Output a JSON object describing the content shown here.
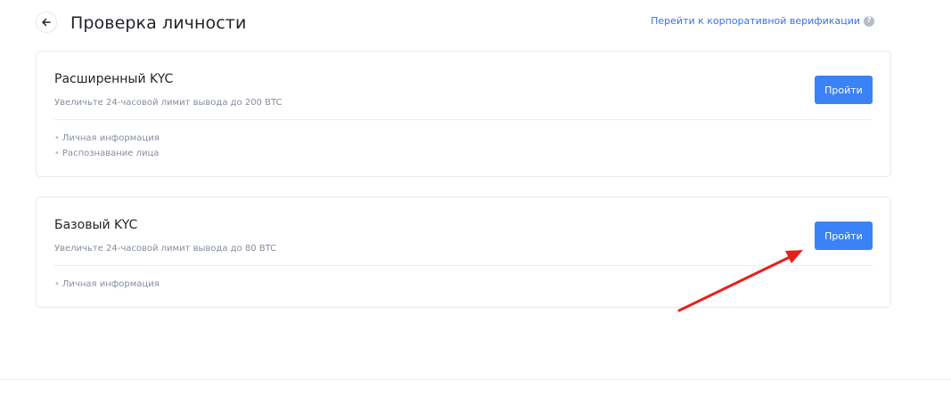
{
  "header": {
    "title": "Проверка личности",
    "back_icon": "arrow-left-icon",
    "corporate_link": "Перейти к корпоративной верификации",
    "help_icon": "question-circle-icon",
    "help_glyph": "?"
  },
  "cards": [
    {
      "title": "Расширенный KYC",
      "subtitle": "Увеличьте 24-часовой лимит вывода до 200 BTC",
      "items": [
        "Личная информация",
        "Распознавание лица"
      ],
      "button": "Пройти"
    },
    {
      "title": "Базовый KYC",
      "subtitle": "Увеличьте 24-часовой лимит вывода до 80 BTC",
      "items": [
        "Личная информация"
      ],
      "button": "Пройти"
    }
  ],
  "bullet": "•",
  "colors": {
    "accent": "#3b82f6",
    "link": "#3a6ee8",
    "annotation": "#e8201c",
    "text_muted": "#848e9c"
  },
  "annotation": {
    "type": "arrow",
    "icon": "red-arrow-annotation",
    "points_to": "cards.1.button"
  }
}
